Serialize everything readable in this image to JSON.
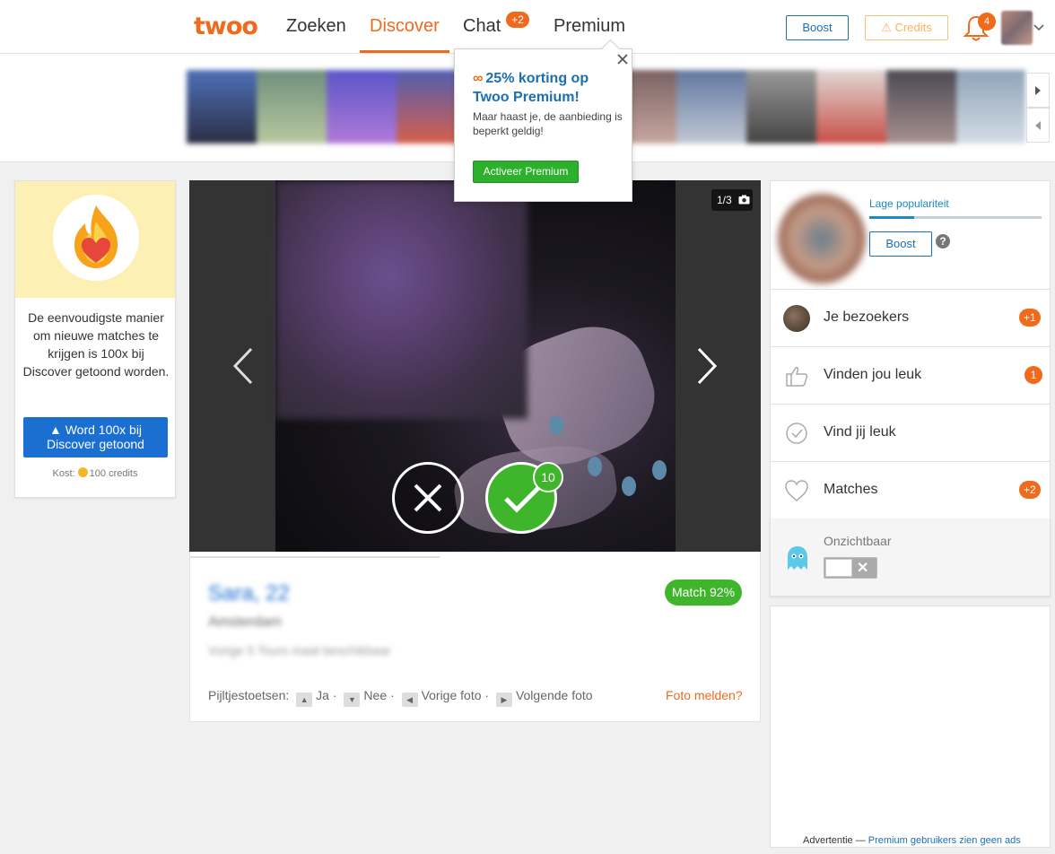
{
  "header": {
    "logo": "twoo",
    "nav": [
      {
        "label": "Zoeken"
      },
      {
        "label": "Discover"
      },
      {
        "label": "Chat",
        "badge": "+2"
      },
      {
        "label": "Premium"
      }
    ],
    "boost_label": "Boost",
    "credits_label": "Credits",
    "notifications_count": "4",
    "active_nav": "Discover"
  },
  "promo": {
    "title": "25% korting op Twoo Premium!",
    "text": "Maar haast je, de aanbieding is beperkt geldig!",
    "button": "Activeer Premium"
  },
  "left_card": {
    "text": "De eenvoudigste manier om nieuwe matches te krijgen is 100x bij Discover getoond worden.",
    "button": "Word 100x bij Discover getoond",
    "cost_prefix": "Kost:",
    "cost": "100 credits"
  },
  "photo": {
    "counter": "1/3",
    "like_badge": "10"
  },
  "profile": {
    "name": "Sara, 22",
    "location": "Amsterdam",
    "last_seen": "Vorige 5 Tours maat beschikbaar",
    "match": "Match 92%",
    "keys_label": "Pijltjestoetsen:",
    "key_yes": "Ja",
    "key_no": "Nee",
    "key_prev": "Vorige foto",
    "key_next": "Volgende foto",
    "report": "Foto melden?"
  },
  "sidebar": {
    "popularity_label": "Lage populariteit",
    "popularity_level": 0.26,
    "boost_label": "Boost",
    "help": "?",
    "items": [
      {
        "label": "Je bezoekers",
        "badge": "+1"
      },
      {
        "label": "Vinden jou leuk",
        "badge": "1"
      },
      {
        "label": "Vind jij leuk",
        "badge": ""
      },
      {
        "label": "Matches",
        "badge": "+2"
      }
    ],
    "invisible_label": "Onzichtbaar"
  },
  "ad": {
    "prefix": "Advertentie —",
    "link": "Premium gebruikers zien geen ads"
  },
  "colors": {
    "brand_orange": "#f06a1d",
    "brand_blue": "#1a6fd1",
    "match_green": "#3fb52b"
  }
}
